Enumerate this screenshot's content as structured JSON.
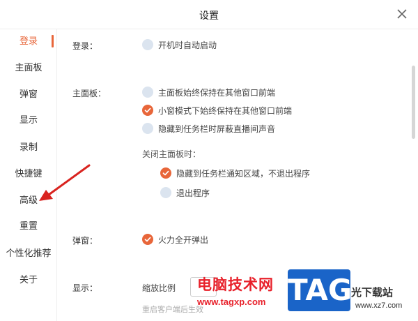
{
  "window": {
    "title": "设置"
  },
  "sidebar": {
    "items": [
      {
        "label": "登录"
      },
      {
        "label": "主面板"
      },
      {
        "label": "弹窗"
      },
      {
        "label": "显示"
      },
      {
        "label": "录制"
      },
      {
        "label": "快捷键"
      },
      {
        "label": "高级"
      },
      {
        "label": "重置"
      },
      {
        "label": "个性化推荐"
      },
      {
        "label": "关于"
      }
    ],
    "active_index": 0
  },
  "sections": {
    "login": {
      "label": "登录：",
      "options": [
        {
          "label": "开机时自动启动",
          "checked": false
        }
      ]
    },
    "main_panel": {
      "label": "主面板：",
      "options": [
        {
          "label": "主面板始终保持在其他窗口前端",
          "checked": false
        },
        {
          "label": "小窗模式下始终保持在其他窗口前端",
          "checked": true
        },
        {
          "label": "隐藏到任务栏时屏蔽直播间声音",
          "checked": false
        }
      ],
      "close_label": "关闭主面板时：",
      "close_options": [
        {
          "label": "隐藏到任务栏通知区域，不退出程序",
          "checked": true
        },
        {
          "label": "退出程序",
          "checked": false
        }
      ]
    },
    "popup": {
      "label": "弹窗：",
      "options": [
        {
          "label": "火力全开弹出",
          "checked": true
        }
      ]
    },
    "display": {
      "label": "显示：",
      "scale_label": "缩放比例",
      "hint": "重启客户端后生效"
    }
  },
  "watermark": {
    "site_name": "电脑技术网",
    "url": "www.tagxp.com",
    "logo": "TAG",
    "right_text": "光下载站",
    "right_url": "www.xz7.com"
  },
  "colors": {
    "accent": "#e8663a",
    "radio_off": "#dbe4ef",
    "arrow": "#d9231f"
  }
}
